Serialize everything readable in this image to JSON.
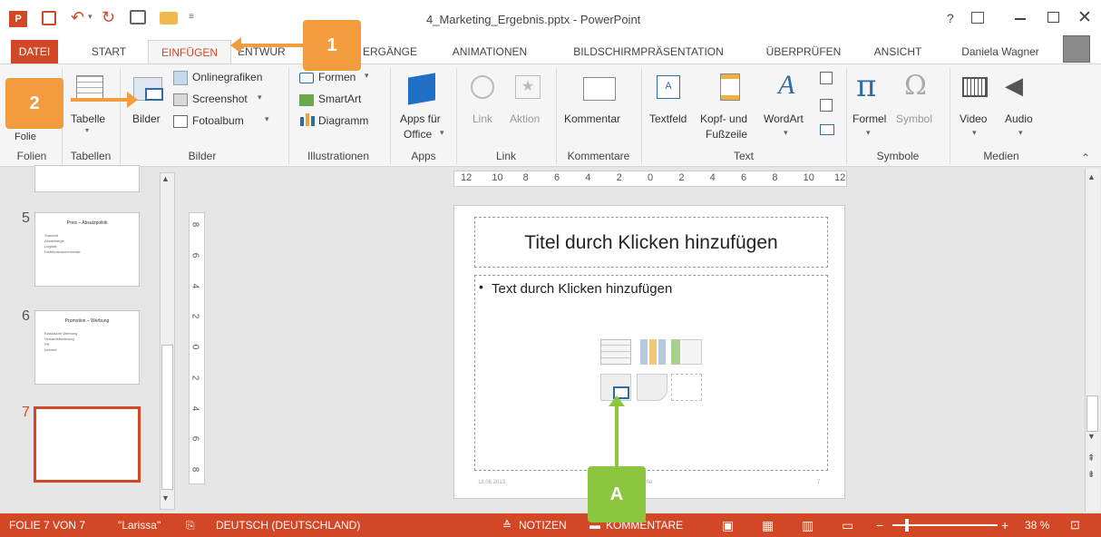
{
  "window": {
    "title": "4_Marketing_Ergebnis.pptx - PowerPoint",
    "help": "?",
    "user": "Daniela Wagner"
  },
  "tabs": [
    "DATEI",
    "START",
    "EINFÜGEN",
    "ENTWURF",
    "ÜBERGÄNGE",
    "ANIMATIONEN",
    "BILDSCHIRMPRÄSENTATION",
    "ÜBERPRÜFEN",
    "ANSICHT"
  ],
  "tabs_visible": {
    "entwurf": "ENTWUR",
    "uebergaenge": "ERGÄNGE"
  },
  "ribbon": {
    "folien": {
      "btn": "Folie",
      "label": "Folien"
    },
    "tabellen": {
      "btn": "Tabelle",
      "label": "Tabellen"
    },
    "bilder": {
      "btn": "Bilder",
      "online": "Onlinegrafiken",
      "screenshot": "Screenshot",
      "fotoalbum": "Fotoalbum",
      "label": "Bilder"
    },
    "illustrationen": {
      "formen": "Formen",
      "smartart": "SmartArt",
      "diagramm": "Diagramm",
      "label": "Illustrationen"
    },
    "apps": {
      "btn1": "Apps für",
      "btn2": "Office",
      "label": "Apps"
    },
    "link": {
      "link": "Link",
      "aktion": "Aktion",
      "label": "Link"
    },
    "kommentare": {
      "btn": "Kommentar",
      "label": "Kommentare"
    },
    "text": {
      "textfeld": "Textfeld",
      "kopf1": "Kopf- und",
      "kopf2": "Fußzeile",
      "wordart": "WordArt",
      "label": "Text"
    },
    "symbole": {
      "formel": "Formel",
      "symbol": "Symbol",
      "label": "Symbole"
    },
    "medien": {
      "video": "Video",
      "audio": "Audio",
      "label": "Medien"
    }
  },
  "ruler": {
    "horizontal": [
      "12",
      "10",
      "8",
      "6",
      "4",
      "2",
      "0",
      "2",
      "4",
      "6",
      "8",
      "10",
      "12"
    ],
    "vertical": [
      "8",
      "6",
      "4",
      "2",
      "0",
      "2",
      "4",
      "6",
      "8"
    ]
  },
  "thumbnails": [
    {
      "num": "5",
      "title": "Preis – Absatzpolitik",
      "bullets": [
        "Standort",
        "Absatzwege",
        "Logistik",
        "Distributionsmerkmale"
      ]
    },
    {
      "num": "6",
      "title": "Promotion – Werbung",
      "bullets": [
        "Klassische Werbung",
        "Verkaufsförderung",
        "PR",
        "Internet"
      ]
    },
    {
      "num": "7",
      "title": "",
      "bullets": []
    }
  ],
  "slide": {
    "title_placeholder": "Titel durch Klicken hinzufügen",
    "text_placeholder": "Text durch Klicken hinzufügen",
    "footer_date": "18.06.2013",
    "footer_center": "...me",
    "footer_num": "7"
  },
  "status": {
    "slide": "FOLIE 7 VON 7",
    "theme": "\"Larissa\"",
    "lang": "DEUTSCH (DEUTSCHLAND)",
    "notes": "NOTIZEN",
    "comments": "KOMMENTARE",
    "zoom": "38 %"
  },
  "callouts": {
    "one": "1",
    "two": "2",
    "a": "A"
  },
  "colors": {
    "accent": "#d24726",
    "callout_orange": "#f39c3e",
    "callout_green": "#8cc63f"
  }
}
